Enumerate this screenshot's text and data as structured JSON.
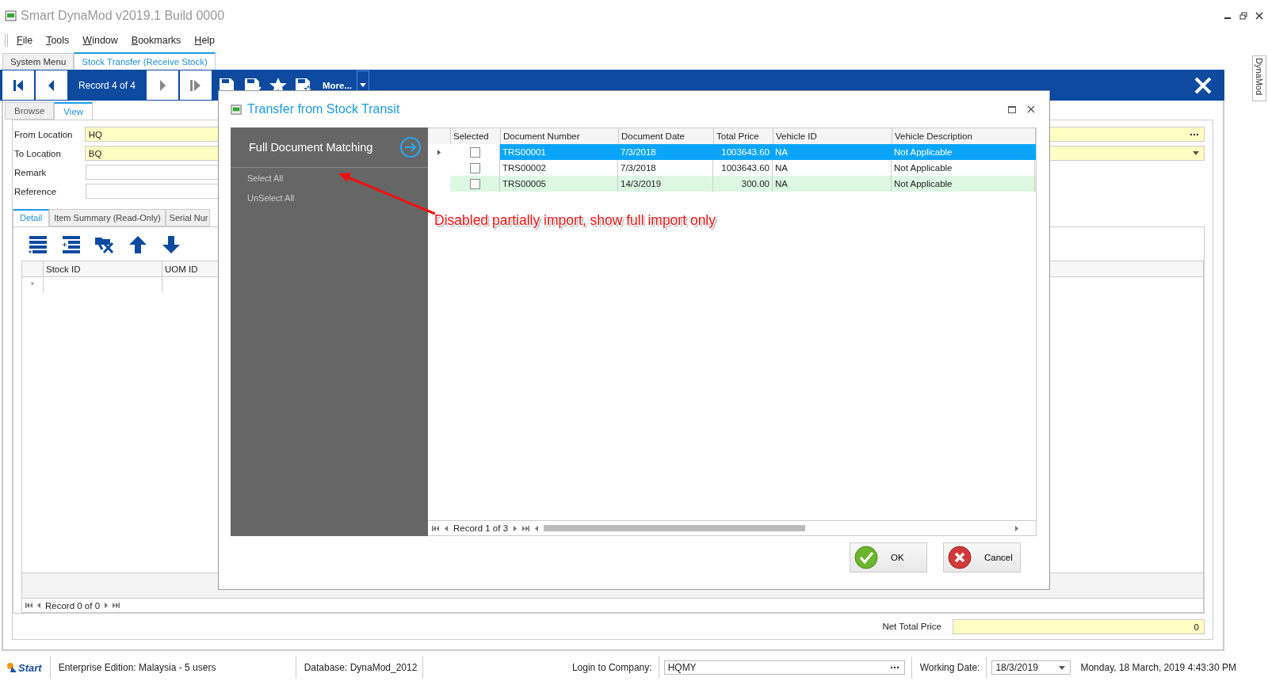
{
  "window": {
    "title": "Smart DynaMod v2019.1 Build 0000"
  },
  "menu": [
    "File",
    "Tools",
    "Window",
    "Bookmarks",
    "Help"
  ],
  "document_tabs": [
    {
      "label": "System Menu",
      "selected": false
    },
    {
      "label": "Stock Transfer (Receive Stock)",
      "selected": true
    }
  ],
  "toolbar": {
    "record": "Record 4 of 4",
    "more": "More..."
  },
  "side_tab": "DynaMod",
  "view_tabs": [
    {
      "label": "Browse",
      "selected": false
    },
    {
      "label": "View",
      "selected": true
    }
  ],
  "form": [
    {
      "label": "From Location",
      "value": "HQ",
      "kind": "lookup",
      "required": true
    },
    {
      "label": "To Location",
      "value": "BQ",
      "kind": "dropdown",
      "required": true
    },
    {
      "label": "Remark",
      "kind": "text",
      "required": false
    },
    {
      "label": "Reference",
      "kind": "text",
      "required": false
    }
  ],
  "detail_tabs": [
    {
      "label": "Detail",
      "selected": true
    },
    {
      "label": "Item Summary (Read-Only)",
      "selected": false
    },
    {
      "label": "Serial Nur",
      "selected": false
    }
  ],
  "detail_grid": {
    "columns": [
      "Stock ID",
      "UOM ID"
    ],
    "new_row_marker": "*",
    "nav": "Record 0 of 0"
  },
  "net_total": {
    "label": "Net Total Price",
    "value": "0"
  },
  "dialog": {
    "title": "Transfer from Stock Transit",
    "panel": {
      "heading": "Full Document Matching",
      "actions": [
        "Select All",
        "UnSelect All"
      ]
    },
    "grid": {
      "checkbox_column": "Selected",
      "columns": [
        "Document Number",
        "Document Date",
        "Total Price",
        "Vehicle ID",
        "Vehicle Description"
      ],
      "rows": [
        {
          "selected": true,
          "checked": false,
          "cells": [
            "TRS00001",
            "7/3/2018",
            "1003643.60",
            "NA",
            "Not Applicable"
          ]
        },
        {
          "selected": false,
          "checked": false,
          "color": "#ffffff",
          "cells": [
            "TRS00002",
            "7/3/2018",
            "1003643.60",
            "NA",
            "Not Applicable"
          ]
        },
        {
          "selected": false,
          "checked": false,
          "color": "#dcf8e3",
          "cells": [
            "TRS00005",
            "14/3/2019",
            "300.00",
            "NA",
            "Not Applicable"
          ]
        }
      ],
      "nav": "Record 1 of 3"
    },
    "buttons": [
      {
        "label": "OK",
        "kind": "ok"
      },
      {
        "label": "Cancel",
        "kind": "cancel"
      }
    ]
  },
  "annotation": "Disabled partially import, show full import only",
  "status_bar": {
    "start": "Start",
    "edition": "Enterprise Edition: Malaysia - 5 users",
    "database": "Database: DynaMod_2012",
    "company_label": "Login to Company:",
    "company": "HQMY",
    "working_date_label": "Working Date:",
    "working_date": "18/3/2019",
    "datetime": "Monday, 18 March, 2019 4:43:30 PM"
  }
}
